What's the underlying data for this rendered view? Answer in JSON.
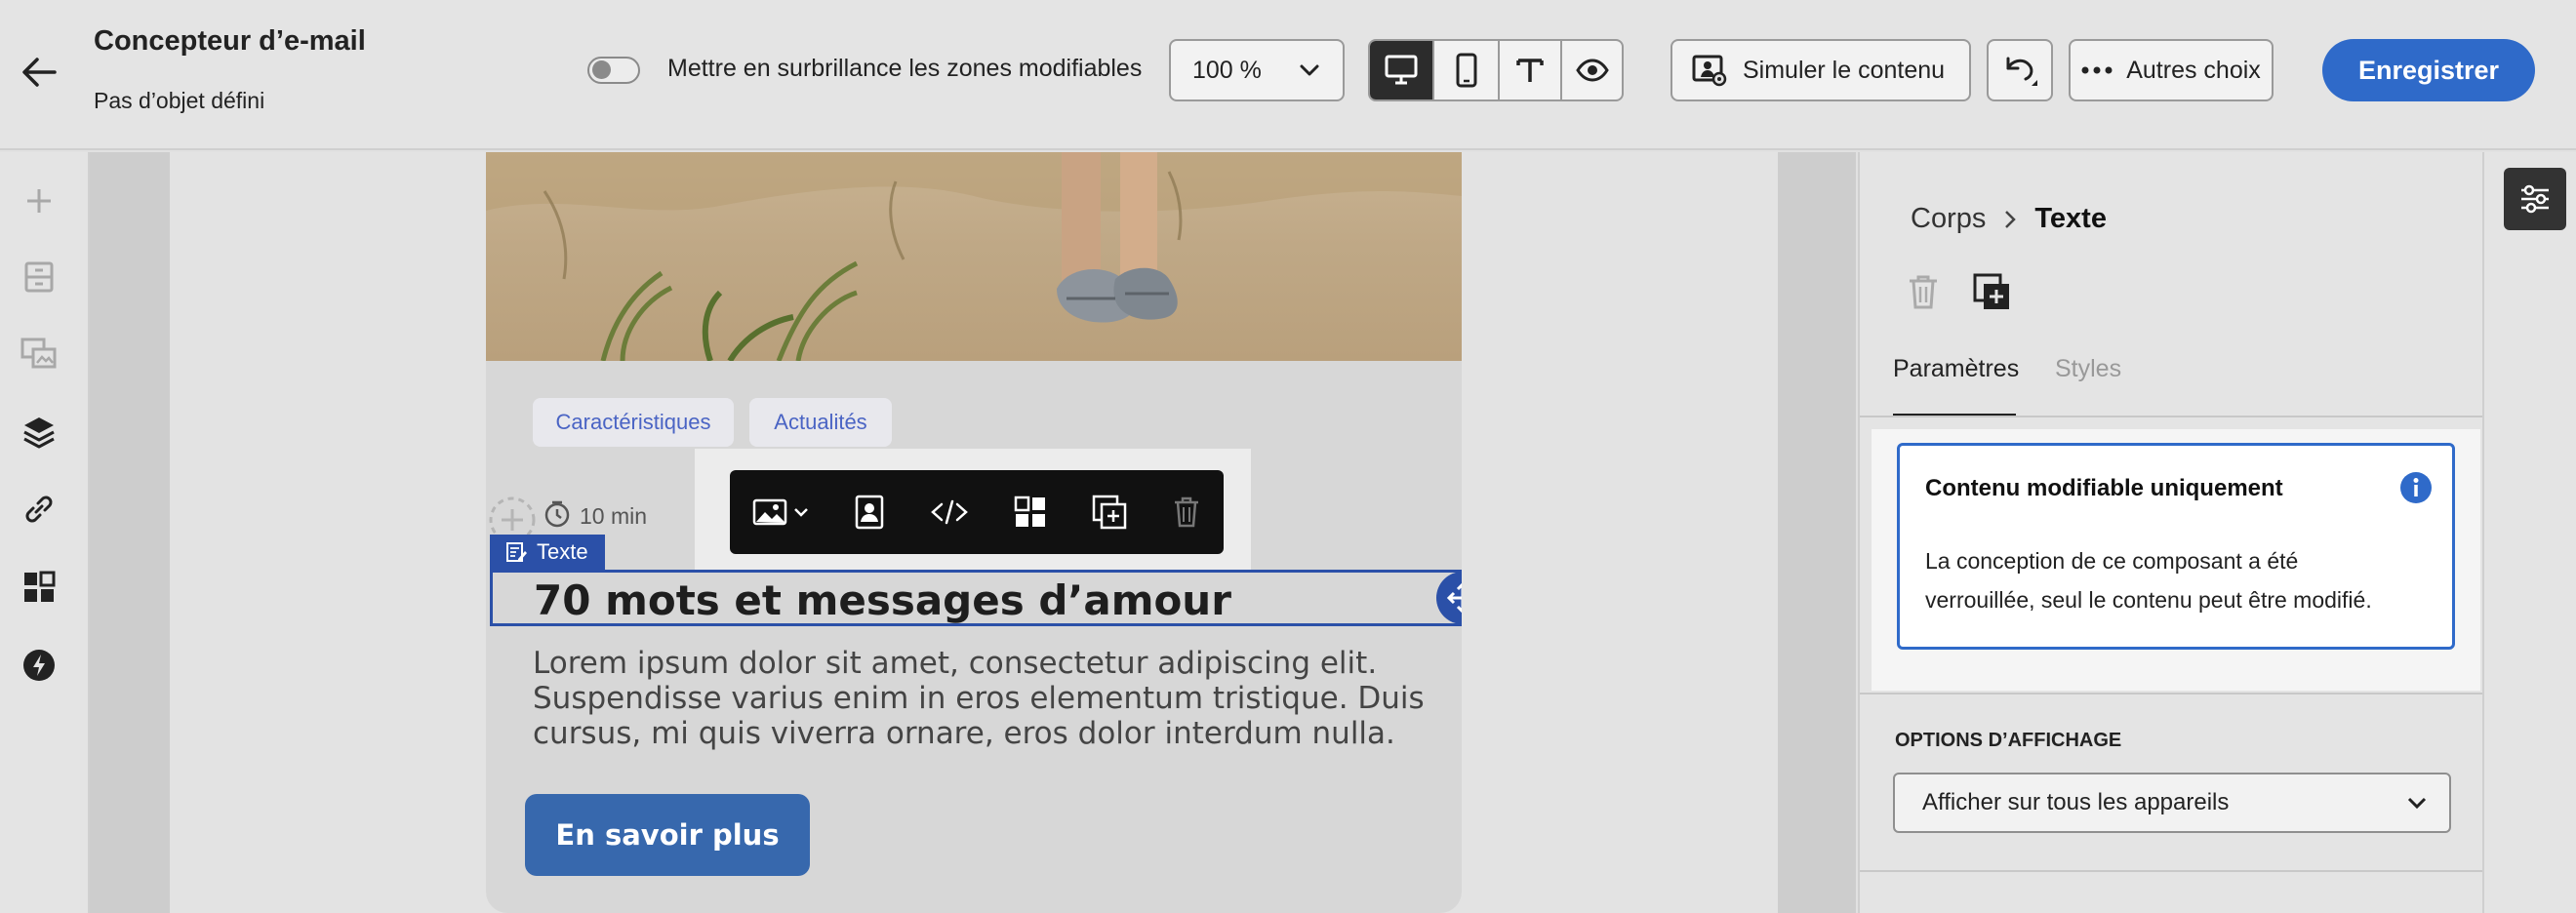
{
  "header": {
    "title": "Concepteur d’e-mail",
    "subtitle": "Pas d’objet défini",
    "highlight_label": "Mettre en surbrillance les zones modifiables",
    "zoom_value": "100 %",
    "simulate_label": "Simuler le contenu",
    "more_label": "Autres choix",
    "save_label": "Enregistrer"
  },
  "email": {
    "tags": [
      "Caractéristiques",
      "Actualités"
    ],
    "read_time": "10 min",
    "component_label": "Texte",
    "heading": "70 mots et messages d’amour",
    "body_lines": [
      "Lorem ipsum dolor sit amet, consectetur adipiscing elit.",
      "Suspendisse varius enim in eros elementum tristique. Duis",
      "cursus, mi quis viverra ornare, eros dolor interdum nulla."
    ],
    "cta_label": "En savoir plus"
  },
  "panel": {
    "breadcrumb_parent": "Corps",
    "breadcrumb_current": "Texte",
    "tab_params": "Paramètres",
    "tab_styles": "Styles",
    "notice_title": "Contenu modifiable uniquement",
    "notice_body_1": "La conception de ce composant a été",
    "notice_body_2": "verrouillée, seul le contenu peut être modifié.",
    "display_section": "OPTIONS D’AFFICHAGE",
    "display_value": "Afficher sur tous les appareils"
  },
  "colors": {
    "accent": "#2f6ac9",
    "selection": "#2b50a8",
    "cta": "#3768ad"
  }
}
